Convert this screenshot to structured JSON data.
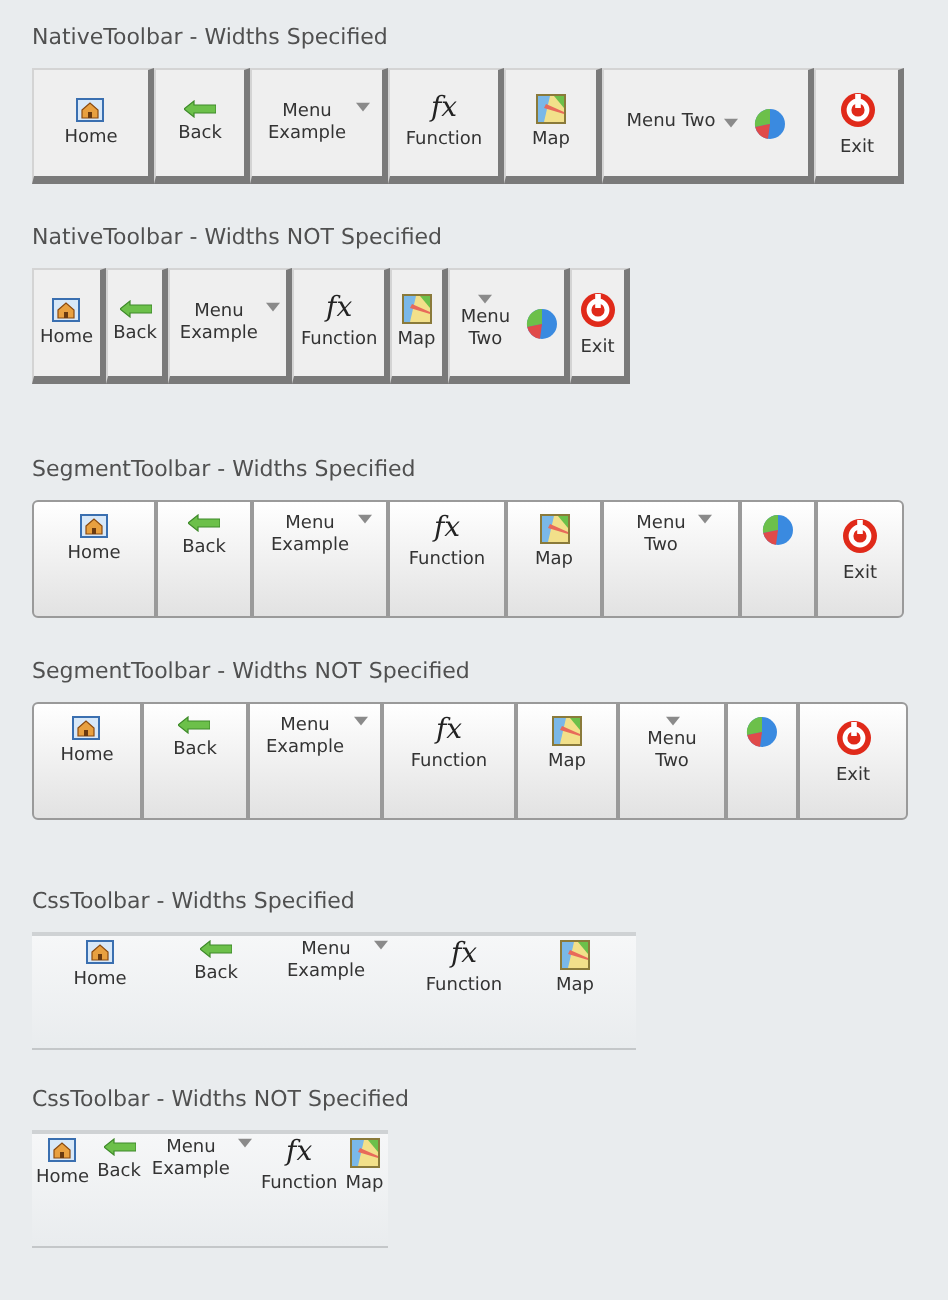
{
  "sections": [
    {
      "title": "NativeToolbar - Widths Specified",
      "kind": "native-fixed",
      "items": [
        {
          "kind": "home",
          "label": "Home"
        },
        {
          "kind": "back",
          "label": "Back"
        },
        {
          "kind": "menu",
          "label": "Menu Example"
        },
        {
          "kind": "function",
          "glyph": "fx",
          "label": "Function"
        },
        {
          "kind": "map",
          "label": "Map"
        },
        {
          "kind": "menu-chart",
          "label": "Menu Two"
        },
        {
          "kind": "exit",
          "label": "Exit"
        }
      ]
    },
    {
      "title": "NativeToolbar - Widths NOT Specified",
      "kind": "native-auto",
      "items": [
        {
          "kind": "home",
          "label": "Home"
        },
        {
          "kind": "back",
          "label": "Back"
        },
        {
          "kind": "menu",
          "label": "Menu Example"
        },
        {
          "kind": "function",
          "glyph": "fx",
          "label": "Function"
        },
        {
          "kind": "map",
          "label": "Map"
        },
        {
          "kind": "menu-chart",
          "label": "Menu Two"
        },
        {
          "kind": "exit",
          "label": "Exit"
        }
      ]
    },
    {
      "title": "SegmentToolbar - Widths Specified",
      "kind": "segment-fixed",
      "items": [
        {
          "kind": "home",
          "label": "Home"
        },
        {
          "kind": "back",
          "label": "Back"
        },
        {
          "kind": "menu",
          "label": "Menu Example"
        },
        {
          "kind": "function",
          "glyph": "fx",
          "label": "Function"
        },
        {
          "kind": "map",
          "label": "Map"
        },
        {
          "kind": "submenu",
          "label": "Menu Two"
        },
        {
          "kind": "chart"
        },
        {
          "kind": "exit",
          "label": "Exit"
        }
      ]
    },
    {
      "title": "SegmentToolbar - Widths NOT Specified",
      "kind": "segment-auto",
      "items": [
        {
          "kind": "home",
          "label": "Home"
        },
        {
          "kind": "back",
          "label": "Back"
        },
        {
          "kind": "menu",
          "label": "Menu Example"
        },
        {
          "kind": "function",
          "glyph": "fx",
          "label": "Function"
        },
        {
          "kind": "map",
          "label": "Map"
        },
        {
          "kind": "submenu",
          "label": "Menu Two"
        },
        {
          "kind": "chart"
        },
        {
          "kind": "exit",
          "label": "Exit"
        }
      ]
    },
    {
      "title": "CssToolbar - Widths Specified",
      "kind": "css-fixed",
      "items": [
        {
          "kind": "home",
          "label": "Home"
        },
        {
          "kind": "back",
          "label": "Back"
        },
        {
          "kind": "menu",
          "label": "Menu Example"
        },
        {
          "kind": "function",
          "glyph": "fx",
          "label": "Function"
        },
        {
          "kind": "map",
          "label": "Map"
        }
      ]
    },
    {
      "title": "CssToolbar - Widths NOT Specified",
      "kind": "css-auto",
      "items": [
        {
          "kind": "home",
          "label": "Home"
        },
        {
          "kind": "back",
          "label": "Back"
        },
        {
          "kind": "menu",
          "label": "Menu Example"
        },
        {
          "kind": "function",
          "glyph": "fx",
          "label": "Function"
        },
        {
          "kind": "map",
          "label": "Map"
        }
      ]
    }
  ]
}
